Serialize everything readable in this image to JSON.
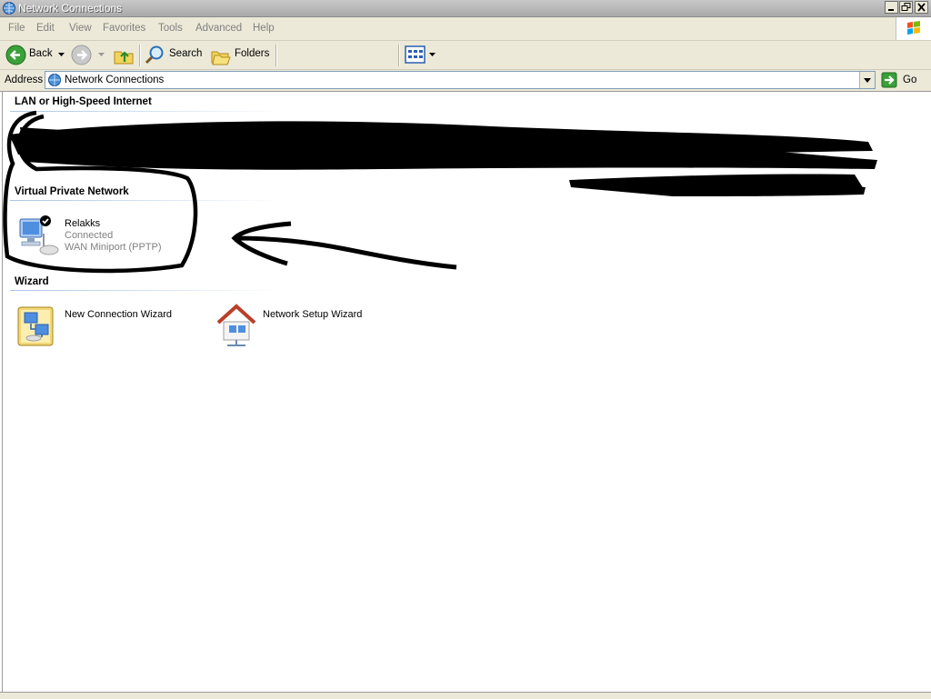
{
  "window": {
    "title": "Network Connections"
  },
  "menu": {
    "items": [
      "File",
      "Edit",
      "View",
      "Favorites",
      "Tools",
      "Advanced",
      "Help"
    ]
  },
  "toolbar": {
    "back_label": "Back",
    "search_label": "Search",
    "folders_label": "Folders"
  },
  "address": {
    "label": "Address",
    "value": "Network Connections",
    "go_label": "Go"
  },
  "groups": {
    "lan": {
      "title": "LAN or High-Speed Internet"
    },
    "vpn": {
      "title": "Virtual Private Network",
      "item": {
        "name": "Relakks",
        "status": "Connected",
        "device": "WAN Miniport (PPTP)"
      }
    },
    "wizard": {
      "title": "Wizard",
      "items": [
        "New Connection Wizard",
        "Network Setup Wizard"
      ]
    }
  },
  "colors": {
    "title_bar": "#a9a9a9",
    "chrome": "#ece9d8",
    "accent": "#0b5fc5",
    "go_green": "#3aa03a",
    "stop_red": "#d42020"
  }
}
